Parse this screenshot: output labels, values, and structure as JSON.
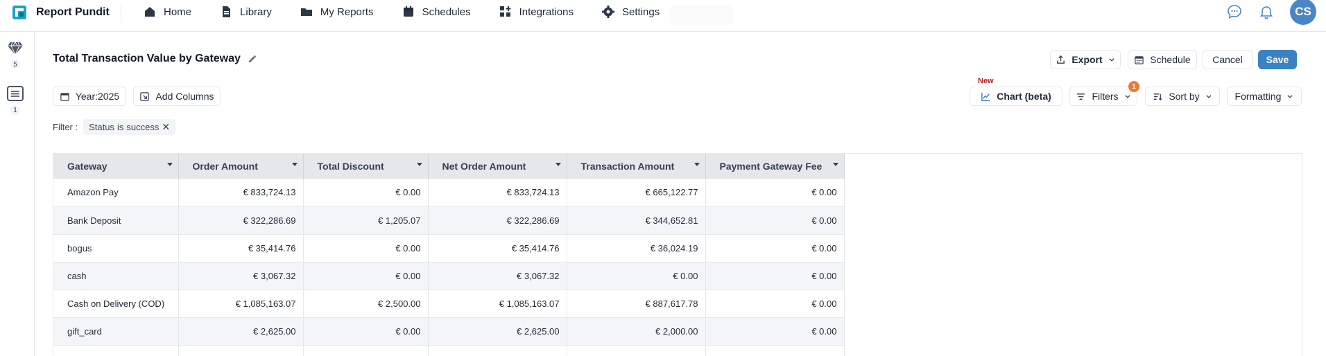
{
  "brand": {
    "name": "Report Pundit",
    "accent": "#1aa3c9"
  },
  "nav": [
    {
      "label": "Home",
      "icon": "home-icon"
    },
    {
      "label": "Library",
      "icon": "file-icon"
    },
    {
      "label": "My Reports",
      "icon": "folder-icon"
    },
    {
      "label": "Schedules",
      "icon": "calendar-icon"
    },
    {
      "label": "Integrations",
      "icon": "grid-plus-icon"
    },
    {
      "label": "Settings",
      "icon": "gear-icon"
    }
  ],
  "user": {
    "initials": "CS"
  },
  "rail": [
    {
      "icon": "gem-icon",
      "count": "5"
    },
    {
      "icon": "list-icon",
      "count": "1"
    }
  ],
  "report": {
    "title": "Total Transaction Value by Gateway",
    "actions": {
      "export": "Export",
      "schedule": "Schedule",
      "cancel": "Cancel",
      "save": "Save"
    },
    "toolbar": {
      "year": "Year:2025",
      "add_columns": "Add Columns",
      "new_label": "New",
      "chart": "Chart (beta)",
      "filters": "Filters",
      "filters_count": "1",
      "sort_by": "Sort by",
      "formatting": "Formatting"
    },
    "filter": {
      "label": "Filter :",
      "field": "Status",
      "op": "is",
      "value": "success"
    }
  },
  "table": {
    "columns": [
      "Gateway",
      "Order Amount",
      "Total Discount",
      "Net Order Amount",
      "Transaction Amount",
      "Payment Gateway Fee"
    ],
    "rows": [
      [
        "Amazon Pay",
        "€ 833,724.13",
        "€ 0.00",
        "€ 833,724.13",
        "€ 665,122.77",
        "€ 0.00"
      ],
      [
        "Bank Deposit",
        "€ 322,286.69",
        "€ 1,205.07",
        "€ 322,286.69",
        "€ 344,652.81",
        "€ 0.00"
      ],
      [
        "bogus",
        "€ 35,414.76",
        "€ 0.00",
        "€ 35,414.76",
        "€ 36,024.19",
        "€ 0.00"
      ],
      [
        "cash",
        "€ 3,067.32",
        "€ 0.00",
        "€ 3,067.32",
        "€ 0.00",
        "€ 0.00"
      ],
      [
        "Cash on Delivery (COD)",
        "€ 1,085,163.07",
        "€ 2,500.00",
        "€ 1,085,163.07",
        "€ 887,617.78",
        "€ 0.00"
      ],
      [
        "gift_card",
        "€ 2,625.00",
        "€ 0.00",
        "€ 2,625.00",
        "€ 2,000.00",
        "€ 0.00"
      ]
    ]
  }
}
